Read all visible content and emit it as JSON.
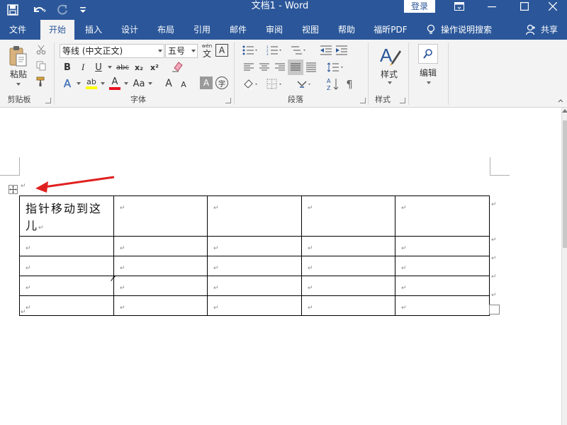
{
  "window": {
    "title": "文档1  -  Word",
    "login_label": "登录",
    "controls": [
      "ribbon-display-icon",
      "minimize-icon",
      "maximize-icon",
      "close-icon"
    ]
  },
  "quick_access": [
    "save-icon",
    "undo-icon",
    "redo-icon",
    "customize-icon"
  ],
  "tabs": [
    {
      "label": "文件"
    },
    {
      "label": "开始",
      "active": true
    },
    {
      "label": "插入"
    },
    {
      "label": "设计"
    },
    {
      "label": "布局"
    },
    {
      "label": "引用"
    },
    {
      "label": "邮件"
    },
    {
      "label": "审阅"
    },
    {
      "label": "视图"
    },
    {
      "label": "帮助"
    },
    {
      "label": "福昕PDF"
    }
  ],
  "tell_me": "操作说明搜索",
  "share": "共享",
  "ribbon": {
    "clipboard": {
      "paste": "粘贴",
      "group": "剪贴板"
    },
    "font": {
      "name": "等线 (中文正文)",
      "size": "五号",
      "group": "字体",
      "buttons": {
        "bold": "B",
        "italic": "I",
        "underline": "U",
        "strike": "abc",
        "sub": "x₂",
        "sup": "x²",
        "change_case": "Aa",
        "char_border": "A",
        "enclose": "字",
        "effects": "A",
        "highlight": "ab",
        "color": "A",
        "grow": "A",
        "shrink": "A",
        "phonetic": "wén",
        "shade": "A"
      }
    },
    "paragraph": {
      "group": "段落"
    },
    "styles": {
      "label": "样式",
      "group": "样式"
    },
    "editing": {
      "label": "编辑"
    }
  },
  "document": {
    "paragraph_mark": "↵",
    "table": {
      "rows": [
        [
          "指针移动到这儿",
          "",
          "",
          "",
          ""
        ],
        [
          "",
          "",
          "",
          "",
          ""
        ],
        [
          "",
          "",
          "",
          "",
          ""
        ],
        [
          "",
          "",
          "",
          "",
          ""
        ],
        [
          "",
          "",
          "",
          "",
          ""
        ]
      ]
    }
  },
  "colors": {
    "accent": "#2b579a",
    "ribbon_bg": "#f3f3f3",
    "arrow": "#e02020",
    "font_color": "#e81123",
    "highlight": "#ffff00"
  }
}
